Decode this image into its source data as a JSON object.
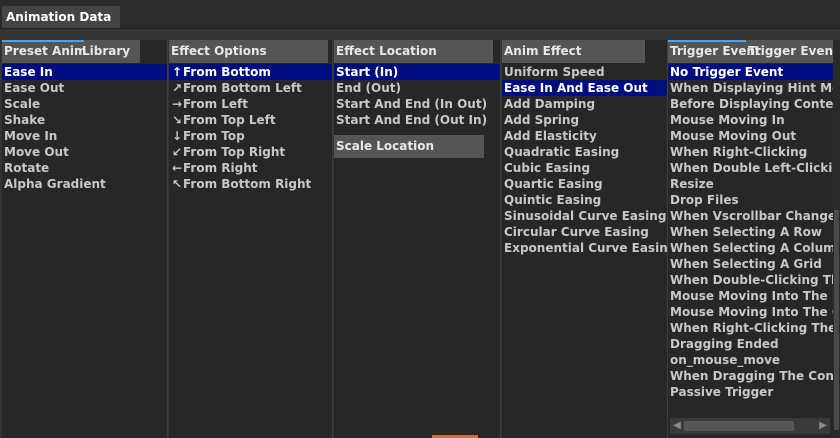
{
  "window": {
    "tab_title": "Animation Data"
  },
  "columns": {
    "preset": {
      "header": "Preset Anim",
      "header_overflow": "Library",
      "items": [
        "Ease In",
        "Ease Out",
        "Scale",
        "Shake",
        "Move In",
        "Move Out",
        "Rotate",
        "Alpha Gradient"
      ],
      "selected": 0
    },
    "effect_options": {
      "header": "Effect Options",
      "items": [
        {
          "icon": "arrow-up-icon",
          "glyph": "↑",
          "label": "From Bottom"
        },
        {
          "icon": "arrow-up-right-icon",
          "glyph": "↗",
          "label": "From Bottom Left"
        },
        {
          "icon": "arrow-right-icon",
          "glyph": "→",
          "label": "From Left"
        },
        {
          "icon": "arrow-down-right-icon",
          "glyph": "↘",
          "label": "From Top Left"
        },
        {
          "icon": "arrow-down-icon",
          "glyph": "↓",
          "label": "From Top"
        },
        {
          "icon": "arrow-down-left-icon",
          "glyph": "↙",
          "label": "From Top Right"
        },
        {
          "icon": "arrow-left-icon",
          "glyph": "←",
          "label": "From Right"
        },
        {
          "icon": "arrow-up-left-icon",
          "glyph": "↖",
          "label": "From Bottom Right"
        }
      ],
      "selected": 0
    },
    "effect_location": {
      "header": "Effect Location",
      "items": [
        "Start (In)",
        "End (Out)",
        "Start And End (In Out)",
        "Start And End (Out In)"
      ],
      "selected": 0,
      "scale_location_header": "Scale Location"
    },
    "anim_effect": {
      "header": "Anim Effect",
      "items": [
        "Uniform Speed",
        "Ease In And Ease Out",
        "Add Damping",
        "Add Spring",
        "Add Elasticity",
        "Quadratic Easing",
        "Cubic Easing",
        "Quartic Easing",
        "Quintic Easing",
        "Sinusoidal Curve Easing",
        "Circular Curve Easing",
        "Exponential Curve Easing"
      ],
      "selected": 1
    },
    "trigger_event": {
      "header": "Trigger Event",
      "header_overflow": "Trigger Event",
      "items": [
        "No Trigger Event",
        "When Displaying Hint Messa",
        "Before Displaying Context M",
        "Mouse Moving In",
        "Mouse Moving Out",
        "When Right-Clicking",
        "When Double Left-Clicking",
        "Resize",
        "Drop Files",
        "When Vscrollbar Changes",
        "When Selecting A Row",
        "When Selecting A Column",
        "When Selecting A Grid",
        "When Double-Clicking The G",
        "Mouse Moving Into The Row",
        "Mouse Moving Into The Colu",
        "When Right-Clicking The Gri",
        "Dragging Ended",
        "on_mouse_move",
        "When Dragging The Control",
        "Passive Trigger"
      ],
      "selected": 0
    }
  },
  "colors": {
    "selection": "#000e80",
    "accent": "#3fa6ff",
    "background": "#333333",
    "panel": "#272727"
  }
}
